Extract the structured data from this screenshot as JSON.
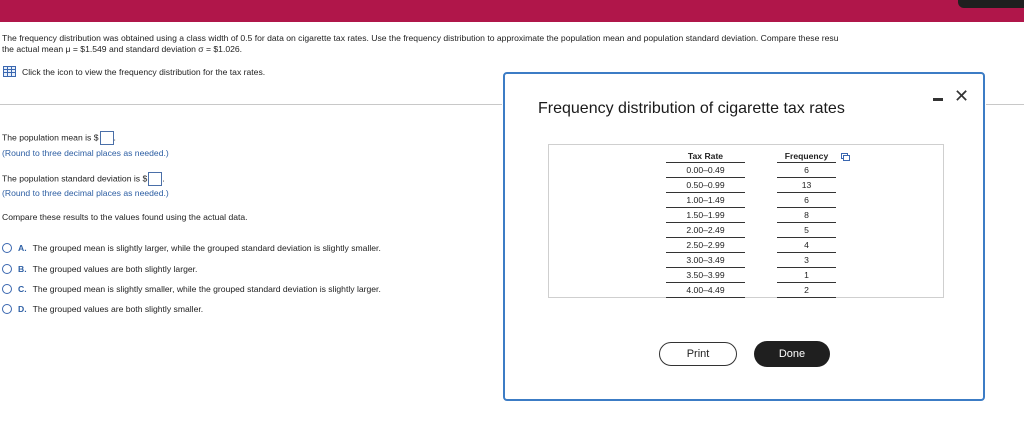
{
  "question": {
    "line1": "The frequency distribution was obtained using a class width of 0.5 for data on cigarette tax rates. Use the frequency distribution to approximate the population mean and population standard deviation. Compare these resu",
    "line2": "the actual mean μ = $1.549 and standard deviation σ = $1.026."
  },
  "view_link": "Click the icon to view the frequency distribution for the tax rates.",
  "answers": {
    "mean_label": "The population mean is $",
    "mean_hint": "(Round to three decimal places as needed.)",
    "sd_label": "The population standard deviation is $",
    "sd_hint": "(Round to three decimal places as needed.)",
    "compare_label": "Compare these results to the values found using the actual data.",
    "dot": "."
  },
  "choices": [
    {
      "letter": "A.",
      "text": "The grouped mean is slightly larger, while the grouped standard deviation is slightly smaller."
    },
    {
      "letter": "B.",
      "text": "The grouped values are both slightly larger."
    },
    {
      "letter": "C.",
      "text": "The grouped mean is slightly smaller, while the grouped standard deviation is slightly larger."
    },
    {
      "letter": "D.",
      "text": "The grouped values are both slightly smaller."
    }
  ],
  "dialog": {
    "title": "Frequency distribution of cigarette tax rates",
    "close_symbol": "✕",
    "table": {
      "headers": [
        "Tax Rate",
        "Frequency"
      ],
      "rows": [
        [
          "0.00–0.49",
          "6"
        ],
        [
          "0.50–0.99",
          "13"
        ],
        [
          "1.00–1.49",
          "6"
        ],
        [
          "1.50–1.99",
          "8"
        ],
        [
          "2.00–2.49",
          "5"
        ],
        [
          "2.50–2.99",
          "4"
        ],
        [
          "3.00–3.49",
          "3"
        ],
        [
          "3.50–3.99",
          "1"
        ],
        [
          "4.00–4.49",
          "2"
        ]
      ]
    },
    "print_label": "Print",
    "done_label": "Done"
  },
  "colors": {
    "top_bar": "#b0164a",
    "link_blue": "#2c5ea3",
    "dialog_border": "#3c7cc5"
  }
}
